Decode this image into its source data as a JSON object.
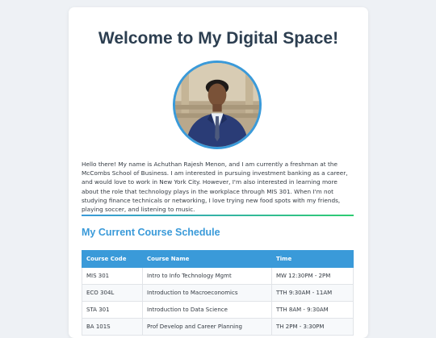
{
  "page": {
    "title": "Welcome to My Digital Space!",
    "bio": "Hello there! My name is Achuthan Rajesh Menon, and I am currently a freshman at the McCombs School of Business. I am interested in pursuing investment banking as a career, and would love to work in New York City. However, I'm also interested in learning more about the role that technology plays in the workplace through MIS 301. When I'm not studying finance technicals or networking, I love trying new food spots with my friends, playing soccer, and listening to music."
  },
  "schedule": {
    "heading": "My Current Course Schedule",
    "columns": [
      "Course Code",
      "Course Name",
      "Time"
    ],
    "rows": [
      {
        "code": "MIS 301",
        "name": "Intro to Info Technology Mgmt",
        "time": "MW 12:30PM - 2PM"
      },
      {
        "code": "ECO 304L",
        "name": "Introduction to Macroeconomics",
        "time": "TTH 9:30AM - 11AM"
      },
      {
        "code": "STA 301",
        "name": "Introduction to Data Science",
        "time": "TTH 8AM - 9:30AM"
      },
      {
        "code": "BA 101S",
        "name": "Prof Develop and Career Planning",
        "time": "TH 2PM - 3:30PM"
      }
    ]
  },
  "colors": {
    "accent": "#3a9ad9",
    "accent_green": "#2ecc71",
    "title": "#2c3e50",
    "background": "#eef1f5"
  }
}
